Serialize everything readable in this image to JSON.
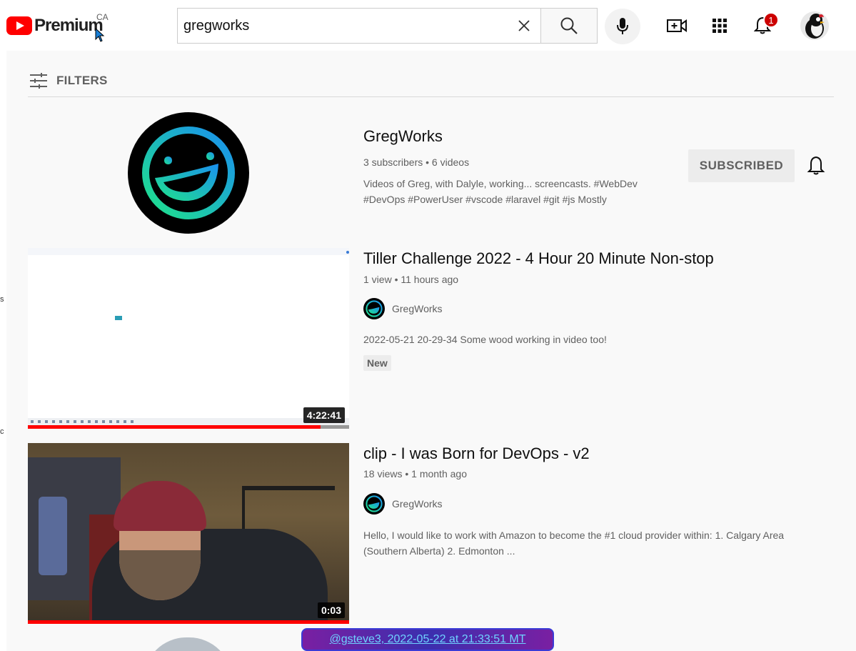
{
  "header": {
    "logo_text": "Premium",
    "region": "CA",
    "search_value": "gregworks",
    "notification_count": "1"
  },
  "left_strip": {
    "chars": [
      "s",
      "c"
    ]
  },
  "filters": {
    "label": "FILTERS"
  },
  "channel": {
    "name": "GregWorks",
    "meta": "3 subscribers • 6 videos",
    "description": "Videos of Greg, with Dalyle, working... screencasts. #WebDev #DevOps #PowerUser #vscode #laravel #git #js Mostly",
    "subscribe_label": "SUBSCRIBED"
  },
  "videos": [
    {
      "title": "Tiller Challenge 2022 - 4 Hour 20 Minute Non-stop",
      "meta": "1 view • 11 hours ago",
      "channel": "GregWorks",
      "description": "2022-05-21 20-29-34 Some wood working in video too!",
      "badge": "New",
      "duration": "4:22:41",
      "watched_fraction": 0.91
    },
    {
      "title": "clip - I was Born for DevOps - v2",
      "meta": "18 views • 1 month ago",
      "channel": "GregWorks",
      "description": "Hello, I would like to work with Amazon to become the #1 cloud provider within: 1. Calgary Area (Southern Alberta) 2. Edmonton ...",
      "duration": "0:03",
      "watched_fraction": 1.0
    }
  ],
  "watermark": {
    "text": "@gsteve3, 2022-05-22 at 21:33:51 MT"
  },
  "colors": {
    "brand": "#ff0000",
    "badge": "#cc0000",
    "watermark": "#6fd3ff"
  }
}
